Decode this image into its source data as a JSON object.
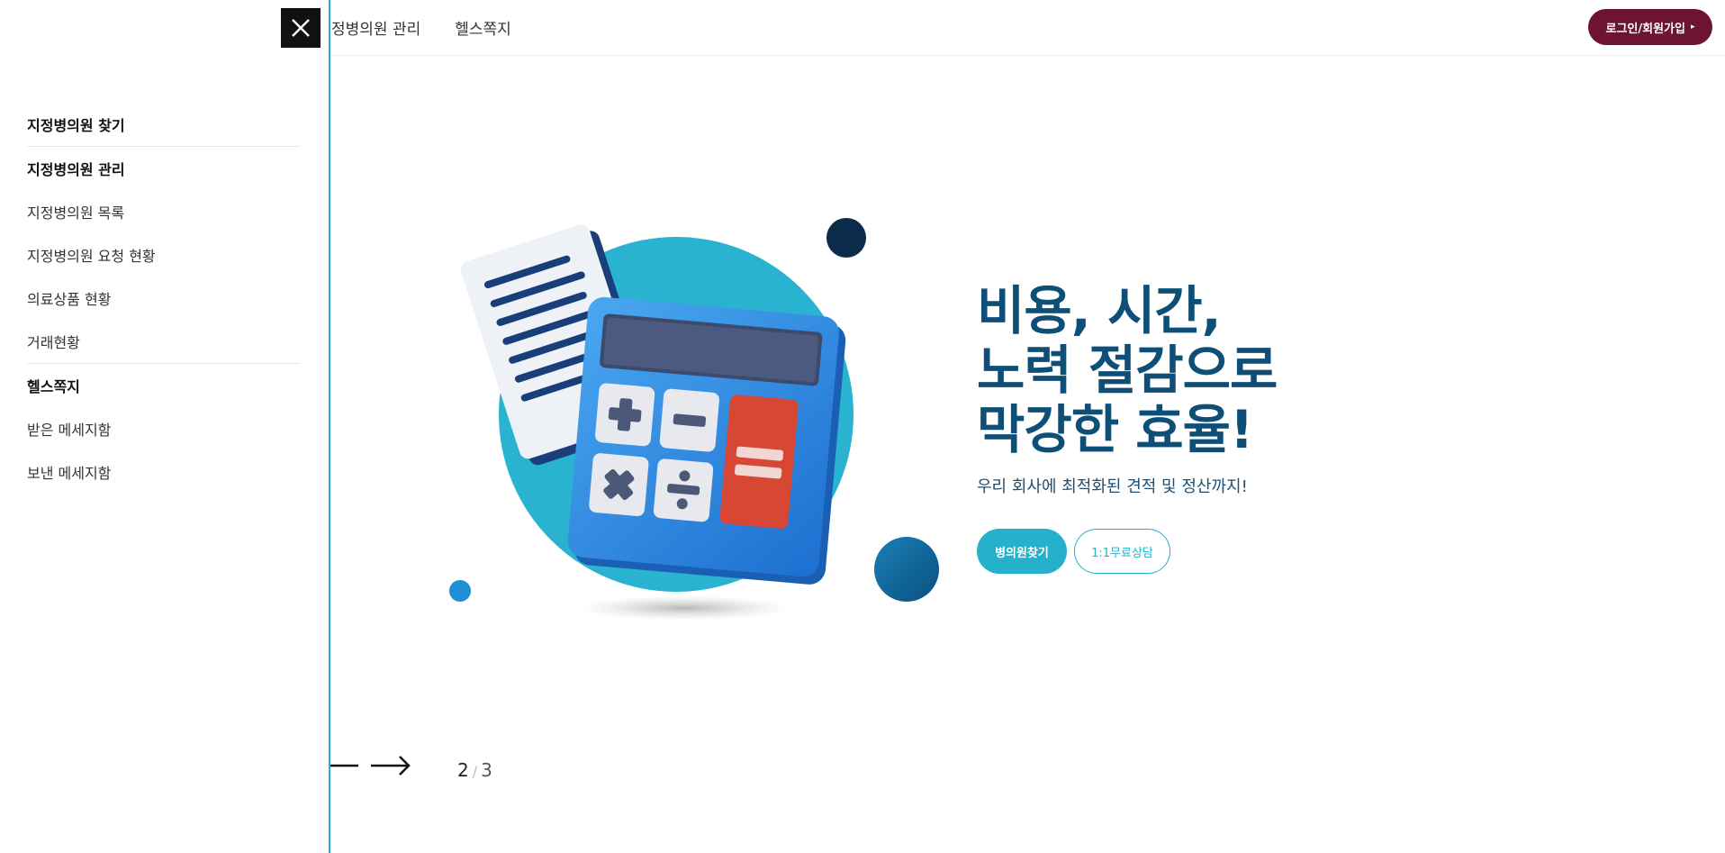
{
  "header": {
    "nav": [
      {
        "label": "정병의원 관리"
      },
      {
        "label": "헬스쪽지"
      }
    ],
    "login_label": "로그인/회원가입",
    "login_arrow": "▸"
  },
  "hero": {
    "title_lines": [
      "비용, 시간,",
      "노력 절감으로",
      "막강한 효율!"
    ],
    "subtitle": "우리 회사에 최적화된 견적 및 정산까지!",
    "primary_button": "병의원찾기",
    "secondary_button": "1:1무료상담"
  },
  "slider": {
    "current": "2",
    "separator": "/",
    "total": "3"
  },
  "drawer": {
    "groups": [
      {
        "title": "지정병의원 찾기",
        "items": []
      },
      {
        "title": "지정병의원 관리",
        "items": [
          {
            "label": "지정병의원 목록"
          },
          {
            "label": "지정병의원 요청 현황"
          },
          {
            "label": "의료상품 현황"
          },
          {
            "label": "거래현황"
          }
        ]
      },
      {
        "title": "헬스쪽지",
        "items": [
          {
            "label": "받은 메세지함"
          },
          {
            "label": "보낸 메세지함"
          }
        ]
      }
    ]
  },
  "icons": {
    "close": "close-icon",
    "prev": "arrow-left-icon",
    "next": "arrow-right-icon"
  },
  "colors": {
    "accent": "#25b0cc",
    "brand": "#6d1530",
    "title": "#0d4f77"
  }
}
